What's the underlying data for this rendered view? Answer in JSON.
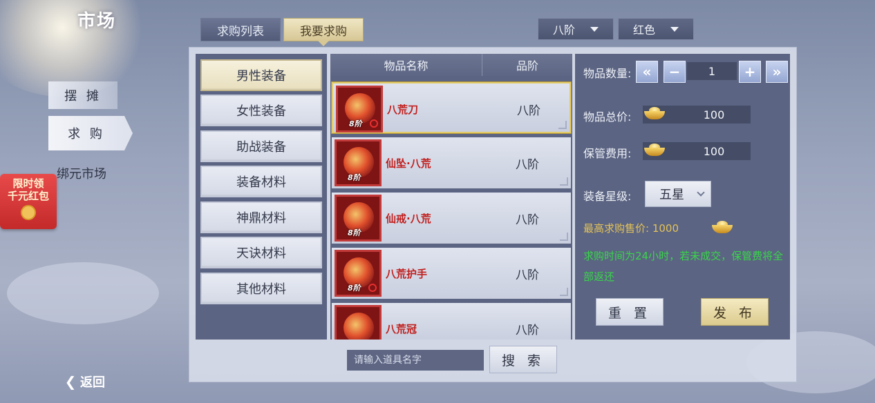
{
  "header": {
    "title": "市场"
  },
  "side_nav": {
    "items": [
      {
        "label": "摆 摊"
      },
      {
        "label": "求 购"
      },
      {
        "label": "绑元市场"
      }
    ]
  },
  "promo": {
    "line1": "限时领",
    "line2": "千元红包"
  },
  "back": {
    "label": "返回"
  },
  "tabs": [
    {
      "label": "求购列表"
    },
    {
      "label": "我要求购"
    }
  ],
  "filters": {
    "grade": "八阶",
    "color": "红色"
  },
  "categories": [
    {
      "label": "男性装备"
    },
    {
      "label": "女性装备"
    },
    {
      "label": "助战装备"
    },
    {
      "label": "装备材料"
    },
    {
      "label": "神鼎材料"
    },
    {
      "label": "天诀材料"
    },
    {
      "label": "其他材料"
    }
  ],
  "item_list": {
    "headers": {
      "name": "物品名称",
      "grade": "品阶"
    },
    "items": [
      {
        "name": "八荒刀",
        "grade": "八阶",
        "badge": "8阶"
      },
      {
        "name": "仙坠·八荒",
        "grade": "八阶",
        "badge": "8阶"
      },
      {
        "name": "仙戒·八荒",
        "grade": "八阶",
        "badge": "8阶"
      },
      {
        "name": "八荒护手",
        "grade": "八阶",
        "badge": "8阶"
      },
      {
        "name": "八荒冠",
        "grade": "八阶",
        "badge": ""
      }
    ]
  },
  "form": {
    "quantity_label": "物品数量:",
    "quantity_value": "1",
    "total_label": "物品总价:",
    "total_value": "100",
    "fee_label": "保管费用:",
    "fee_value": "100",
    "star_label": "装备星级:",
    "star_value": "五星",
    "max_price": "最高求购售价: 1000",
    "notice": "求购时间为24小时，若未成交，保管费将全部返还",
    "reset_label": "重 置",
    "publish_label": "发 布"
  },
  "search": {
    "placeholder": "请输入道具名字",
    "button_label": "搜 索"
  }
}
